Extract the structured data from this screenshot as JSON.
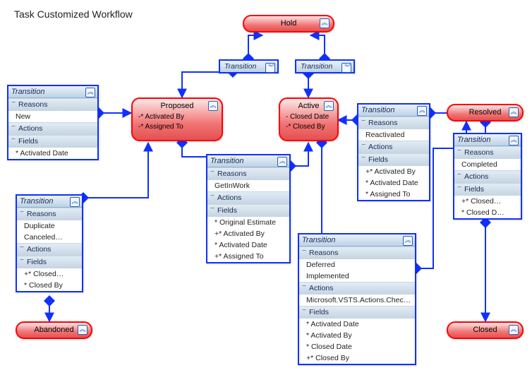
{
  "title": "Task Customized Workflow",
  "chev_up": "︽",
  "chev_down": "︾",
  "states": {
    "hold": {
      "label": "Hold"
    },
    "proposed": {
      "label": "Proposed",
      "lines": [
        "-* Activated By",
        "-* Assigned To"
      ]
    },
    "active": {
      "label": "Active",
      "lines": [
        "- Closed Date",
        "-* Closed By"
      ]
    },
    "resolved": {
      "label": "Resolved"
    },
    "abandoned": {
      "label": "Abandoned"
    },
    "closed": {
      "label": "Closed"
    }
  },
  "chips": {
    "t_hold_left": "Transition",
    "t_hold_right": "Transition"
  },
  "panels": {
    "p_left_top": {
      "title": "Transition",
      "sections": {
        "reasons": {
          "label": "Reasons",
          "rows": [
            "New"
          ]
        },
        "actions": {
          "label": "Actions",
          "rows": []
        },
        "fields": {
          "label": "Fields",
          "rows": [
            "* Activated Date"
          ]
        }
      }
    },
    "p_left_mid": {
      "title": "Transition",
      "sections": {
        "reasons": {
          "label": "Reasons",
          "rows": [
            "Duplicate",
            "Canceled…"
          ]
        },
        "actions": {
          "label": "Actions",
          "rows": []
        },
        "fields": {
          "label": "Fields",
          "rows": [
            "+* Closed…",
            "* Closed By"
          ]
        }
      }
    },
    "p_center": {
      "title": "Transition",
      "sections": {
        "reasons": {
          "label": "Reasons",
          "rows": [
            "GetInWork"
          ]
        },
        "actions": {
          "label": "Actions",
          "rows": []
        },
        "fields": {
          "label": "Fields",
          "rows": [
            "* Original Estimate",
            "+* Activated By",
            "* Activated Date",
            "+* Assigned To"
          ]
        }
      }
    },
    "p_right_react": {
      "title": "Transition",
      "sections": {
        "reasons": {
          "label": "Reasons",
          "rows": [
            "Reactivated"
          ]
        },
        "actions": {
          "label": "Actions",
          "rows": []
        },
        "fields": {
          "label": "Fields",
          "rows": [
            "+* Activated By",
            "* Activated Date",
            "* Assigned To"
          ]
        }
      }
    },
    "p_far_right": {
      "title": "Transition",
      "sections": {
        "reasons": {
          "label": "Reasons",
          "rows": [
            "Completed"
          ]
        },
        "actions": {
          "label": "Actions",
          "rows": []
        },
        "fields": {
          "label": "Fields",
          "rows": [
            "+* Closed…",
            "* Closed D…"
          ]
        }
      }
    },
    "p_bottom_big": {
      "title": "Transition",
      "sections": {
        "reasons": {
          "label": "Reasons",
          "rows": [
            "Deferred",
            "Implemented"
          ]
        },
        "actions": {
          "label": "Actions",
          "rows": [
            "Microsoft.VSTS.Actions.Checkin"
          ]
        },
        "fields": {
          "label": "Fields",
          "rows": [
            "* Activated Date",
            "* Activated By",
            "* Closed Date",
            "+* Closed By"
          ]
        }
      }
    }
  }
}
